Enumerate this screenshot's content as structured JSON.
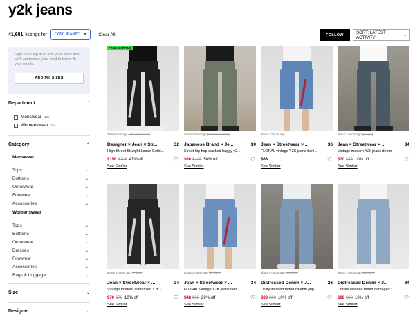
{
  "page": {
    "title": "y2k jeans"
  },
  "filters": {
    "count": "41,681",
    "count_suffix": "listings for",
    "chip_label": "\"Y2K JEANS\"",
    "chip_close": "×",
    "clear_all": "Clear All"
  },
  "actions": {
    "follow": "FOLLOW",
    "sort": "SORT: LATEST ACTIVITY"
  },
  "signup": {
    "text": "Sign up or log in to add your sizes and we'll customize your feed to better fit your needs.",
    "button": "ADD MY SIZES"
  },
  "sidebar": {
    "department": {
      "label": "Department",
      "items": [
        {
          "label": "Menswear",
          "count": "10k+"
        },
        {
          "label": "Womenswear",
          "count": "1k+"
        }
      ]
    },
    "category": {
      "label": "Category",
      "menswear": {
        "label": "Menswear",
        "items": [
          "Tops",
          "Bottoms",
          "Outerwear",
          "Footwear",
          "Accessories"
        ]
      },
      "womenswear": {
        "label": "Womenswear",
        "items": [
          "Tops",
          "Bottoms",
          "Outerwear",
          "Dresses",
          "Footwear",
          "Accessories",
          "Bags & Luggage"
        ]
      }
    },
    "size": {
      "label": "Size"
    },
    "designer": {
      "label": "Designer"
    }
  },
  "listings": [
    {
      "badge": "FREE SHIPPING",
      "time": "28 minutes ago",
      "orig_time": "(about 18 hours)",
      "brand": "Designer × Jean × Str...",
      "size": "32",
      "title": "High Street Straight Loose Gothi...",
      "sale": "$156",
      "orig": "$298",
      "pct": "47% off",
      "similar": "See Similar",
      "style": "dark"
    },
    {
      "badge": "",
      "time": "about 1 hour ago",
      "orig_time": "(about 2 months)",
      "brand": "Japanese Brand × Je...",
      "size": "30",
      "title": "Street hip hop washed baggy y2...",
      "sale": "$60",
      "orig": "$145",
      "pct": "58% off",
      "similar": "See Similar",
      "style": "washed"
    },
    {
      "badge": "",
      "time": "about 2 hours ago",
      "orig_time": "",
      "brand": "Jean × Streetwear × ...",
      "size": "36",
      "title": "FLORAL vintage Y2K jeans deni...",
      "sale": "$68",
      "orig": "",
      "pct": "",
      "similar": "See Similar",
      "style": "shorts"
    },
    {
      "badge": "",
      "time": "about 3 hours ago",
      "orig_time": "(2 days)",
      "brand": "Jean × Streetwear × ...",
      "size": "34",
      "title": "Vintage modern Y2k jeans denim",
      "sale": "$70",
      "orig": "$78",
      "pct": "10% off",
      "similar": "See Similar",
      "style": "baggy"
    },
    {
      "badge": "",
      "time": "about 3 hours ago",
      "orig_time": "(7 days)",
      "brand": "Jean × Streetwear × ...",
      "size": "34",
      "title": "Vintage modern distressed Y2k j...",
      "sale": "$70",
      "orig": "$78",
      "pct": "10% off",
      "similar": "See Similar",
      "style": "black"
    },
    {
      "badge": "",
      "time": "about 3 hours ago",
      "orig_time": "(27 days)",
      "brand": "Jean × Streetwear × ...",
      "size": "34",
      "title": "FLORAL vintage Y2K jeans deni...",
      "sale": "$48",
      "orig": "$68",
      "pct": "29% off",
      "similar": "See Similar",
      "style": "shorts2"
    },
    {
      "badge": "",
      "time": "about 9 hours ago",
      "orig_time": "(26 days)",
      "brand": "Distressed Denim × J...",
      "size": "26",
      "title": "Utility washed faded cleanfit yup...",
      "sale": "$88",
      "orig": "$98",
      "pct": "10% off",
      "similar": "See Similar",
      "style": "street"
    },
    {
      "badge": "",
      "time": "about 3 hours ago",
      "orig_time": "(21 days)",
      "brand": "Distressed Denim × J...",
      "size": "34",
      "title": "Unisex washed faded damaged r...",
      "sale": "$88",
      "orig": "$98",
      "pct": "10% off",
      "similar": "See Similar",
      "style": "light"
    }
  ],
  "colors": {
    "accent_blue": "#3b6cd9",
    "sale_red": "#d0021b",
    "free_shipping_green": "#2de042",
    "signup_bg": "#eef0f8"
  },
  "icons": {
    "chevron": "chevron-down-icon",
    "heart": "heart-icon",
    "close": "close-icon"
  }
}
